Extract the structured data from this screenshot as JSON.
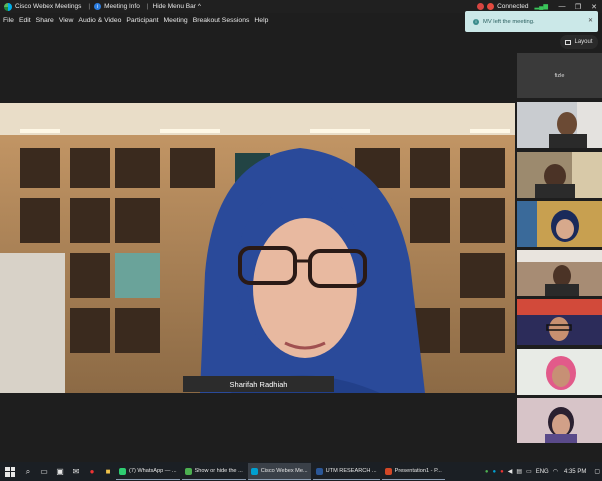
{
  "titlebar": {
    "app_title": "Cisco Webex Meetings",
    "meeting_info": "Meeting Info",
    "hide_menu": "Hide Menu Bar",
    "connection": "Connected"
  },
  "menu": {
    "items": [
      "File",
      "Edit",
      "Share",
      "View",
      "Audio & Video",
      "Participant",
      "Meeting",
      "Breakout Sessions",
      "Help"
    ]
  },
  "toast": {
    "message": "MV left the meeting."
  },
  "layout_label": "Layout",
  "main_video": {
    "participant_name": "Sharifah Radhiah"
  },
  "side_panel": {
    "first_tile_name": "fizle"
  },
  "taskbar": {
    "tasks": [
      {
        "label": "(7) WhatsApp — ...",
        "color": "#2ecc71"
      },
      {
        "label": "Show or hide the ...",
        "color": "#4caf50"
      },
      {
        "label": "Cisco Webex Me...",
        "color": "#00a0d1"
      },
      {
        "label": "UTM RESEARCH ...",
        "color": "#2b5797"
      },
      {
        "label": "Presentation1 - P...",
        "color": "#d24726"
      }
    ],
    "language": "ENG",
    "time": "4:35 PM"
  },
  "colors": {
    "toast_bg": "#cbe8e8",
    "accent": "#2b7de1"
  }
}
